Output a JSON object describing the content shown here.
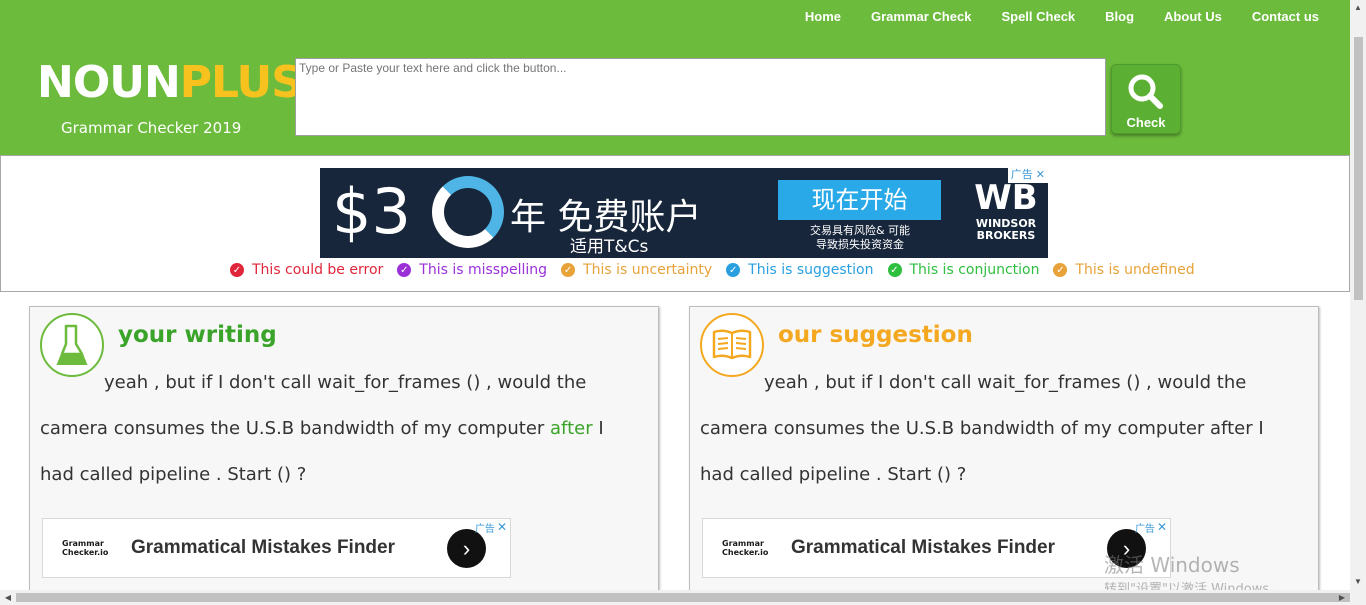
{
  "nav": {
    "items": [
      "Home",
      "Grammar Check",
      "Spell Check",
      "Blog",
      "About Us",
      "Contact us"
    ]
  },
  "logo": {
    "part1": "NOUN",
    "part2": "PLUS",
    "tagline": "Grammar Checker 2019"
  },
  "input": {
    "placeholder": "Type or Paste your text here and click the button...",
    "value": ""
  },
  "check_button": {
    "label": "Check",
    "icon": "magnifier-icon"
  },
  "ad_banner": {
    "big_text": "$3",
    "headline": "年 免费账户",
    "subline": "适用T&Cs",
    "cta": "现在开始",
    "risk_line1": "交易具有风险& 可能",
    "risk_line2": "导致损失投资资金",
    "brand_logo": "WB",
    "brand_line1": "WINDSOR",
    "brand_line2": "BROKERS",
    "ad_tag": "广告",
    "close": "✕"
  },
  "legend": [
    {
      "label": "This could be error",
      "color": "#e0263a"
    },
    {
      "label": "This is misspelling",
      "color": "#9b30d9"
    },
    {
      "label": "This is uncertainty",
      "color": "#e8a23a"
    },
    {
      "label": "This is suggestion",
      "color": "#2a9fe0"
    },
    {
      "label": "This is conjunction",
      "color": "#2fbf3f"
    },
    {
      "label": "This is undefined",
      "color": "#e8a23a"
    }
  ],
  "writing_panel": {
    "title": "your writing",
    "title_color": "#3aa329",
    "icon": "highlighter-icon",
    "text_before": "yeah , but if I don't call wait_for_frames () , would the camera consumes the U.S.B bandwidth of my computer ",
    "highlight": "after",
    "text_after": " I had called pipeline . Start () ?"
  },
  "suggestion_panel": {
    "title": "our suggestion",
    "title_color": "#f4a820",
    "icon": "book-icon",
    "text": "yeah , but if I don't call wait_for_frames () , would the camera consumes the U.S.B bandwidth of my computer after I had called pipeline . Start () ?"
  },
  "mini_ad": {
    "logo_line1": "Grammar",
    "logo_line2": "Checker.io",
    "title": "Grammatical Mistakes Finder",
    "ad_tag": "广告",
    "close": "✕",
    "arrow": "›"
  },
  "watermark": {
    "line1": "激活 Windows",
    "line2": "转到\"设置\"以激活 Windows。"
  },
  "colors": {
    "header_green": "#6cbb3c",
    "accent_yellow": "#f7c21e"
  }
}
